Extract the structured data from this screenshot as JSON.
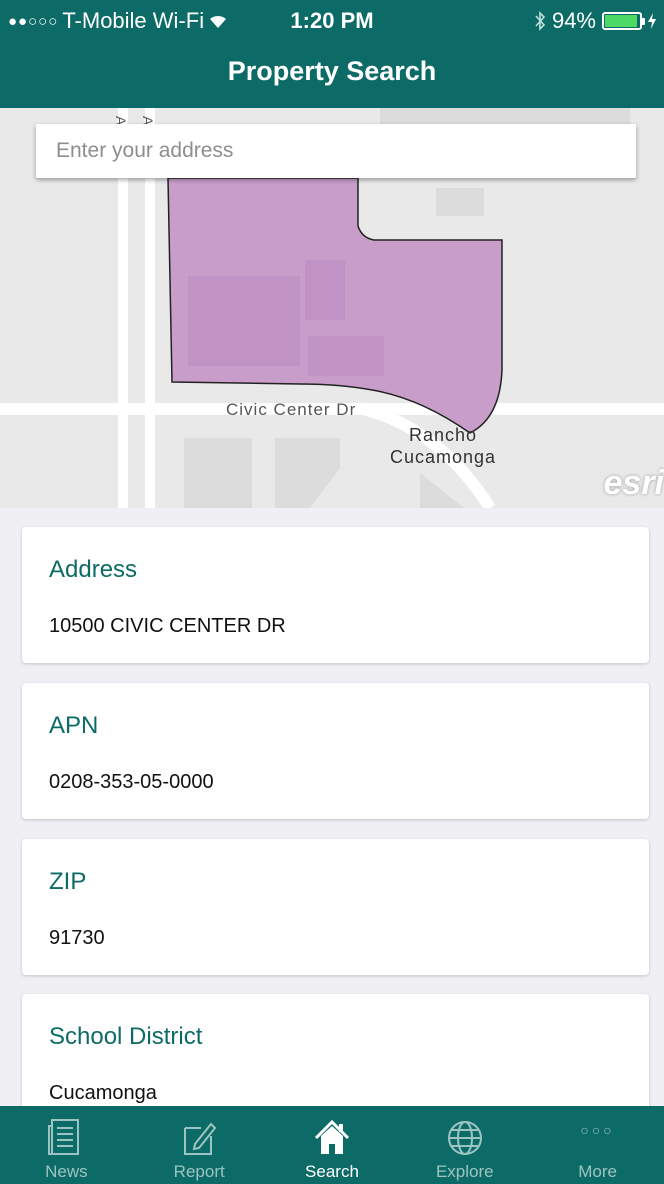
{
  "status": {
    "signal": "●●○○○",
    "carrier": "T-Mobile Wi-Fi",
    "time": "1:20 PM",
    "battery": "94%",
    "battery_level": 0.94
  },
  "nav": {
    "title": "Property Search"
  },
  "search": {
    "placeholder": "Enter your address",
    "value": ""
  },
  "map": {
    "street_label": "Civic Center Dr",
    "city_line1": "Rancho",
    "city_line2": "Cucamonga",
    "road_label_top": "Ave",
    "attribution": "esri",
    "parcel_color": "#c89dca"
  },
  "cards": [
    {
      "label": "Address",
      "value": "10500 CIVIC CENTER DR"
    },
    {
      "label": "APN",
      "value": "0208-353-05-0000"
    },
    {
      "label": "ZIP",
      "value": "91730"
    },
    {
      "label": "School District",
      "value": "Cucamonga"
    }
  ],
  "tabs": [
    {
      "label": "News",
      "icon": "news-icon"
    },
    {
      "label": "Report",
      "icon": "report-icon"
    },
    {
      "label": "Search",
      "icon": "home-icon",
      "active": true
    },
    {
      "label": "Explore",
      "icon": "globe-icon"
    },
    {
      "label": "More",
      "icon": "more-icon"
    }
  ],
  "colors": {
    "brand": "#0d6b67",
    "tab_inactive": "#9cc4c2",
    "background": "#efeff4"
  }
}
